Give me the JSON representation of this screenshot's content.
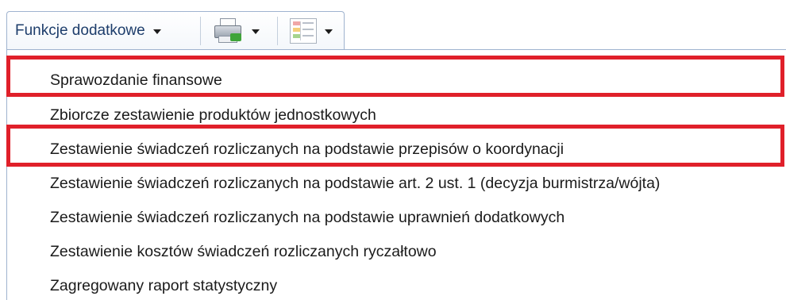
{
  "toolbar": {
    "functions_label": "Funkcje dodatkowe",
    "print_icon": "printer-icon",
    "layout_icon": "layout-icon",
    "dropdown_icon": "chevron-down-icon"
  },
  "menu": {
    "items": [
      {
        "label": "Sprawozdanie finansowe",
        "highlighted": true
      },
      {
        "label": "Zbiorcze zestawienie produktów jednostkowych",
        "highlighted": false
      },
      {
        "label": "Zestawienie świadczeń rozliczanych na podstawie przepisów o koordynacji",
        "highlighted": true
      },
      {
        "label": "Zestawienie świadczeń rozliczanych na podstawie art. 2 ust. 1 (decyzja burmistrza/wójta)",
        "highlighted": false
      },
      {
        "label": "Zestawienie świadczeń rozliczanych na podstawie uprawnień dodatkowych",
        "highlighted": false
      },
      {
        "label": "Zestawienie kosztów świadczeń rozliczanych ryczałtowo",
        "highlighted": false
      },
      {
        "label": "Zagregowany raport statystyczny",
        "highlighted": false
      }
    ]
  },
  "colors": {
    "highlight": "#e0202a",
    "toolbar_text": "#1d3d6b",
    "border": "#9fb3cf"
  }
}
